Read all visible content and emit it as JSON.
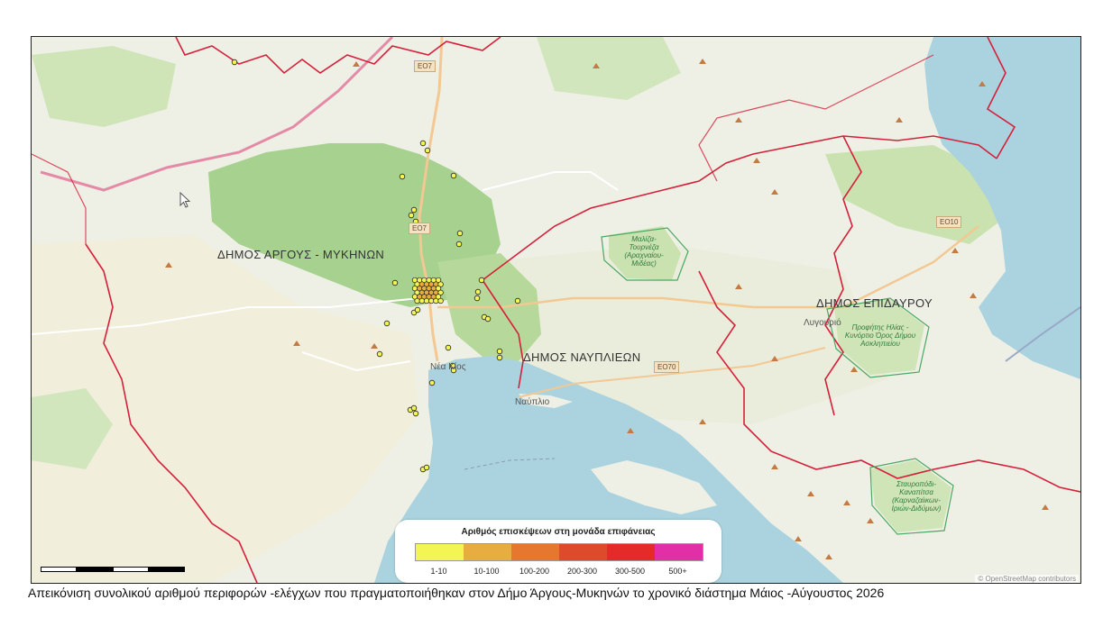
{
  "map": {
    "municipalities": [
      {
        "name": "ΔΗΜΟΣ ΑΡΓΟΥΣ - ΜΥΚΗΝΩΝ"
      },
      {
        "name": "ΔΗΜΟΣ ΝΑΥΠΛΙΕΩΝ"
      },
      {
        "name": "ΔΗΜΟΣ ΕΠΙΔΑΥΡΟΥ"
      }
    ],
    "towns": [
      {
        "name": "Νέα Κίος"
      },
      {
        "name": "Ναύπλιο"
      },
      {
        "name": "Λυγουριό"
      }
    ],
    "protected_areas": [
      {
        "name": "Μαλίζα-Τουρνέζα (Αραχναίου-Μιδέας)"
      },
      {
        "name": "Προφήτης Ηλίας - Κυνόρτιο Όρος Δήμου Ασκληπιείου"
      },
      {
        "name": "Σταυροπόδι-Καναπίτσα (Καρναζαίικων-Ιριών-Διδύμων)"
      }
    ],
    "road_shields": [
      "ΕΟ7",
      "ΕΟ7",
      "ΕΟ70",
      "ΕΟ10"
    ],
    "colors": {
      "water": "#abd3df",
      "forest": "#a7d18e",
      "boundary": "#d61f3a",
      "primary_road": "#e8b9a0",
      "background": "#eef0e6"
    },
    "attribution": "© OpenStreetMap contributors"
  },
  "legend": {
    "title": "Αριθμός επισκέψεων στη μονάδα επιφάνειας",
    "classes": [
      {
        "label": "1-10",
        "color": "#f3f553"
      },
      {
        "label": "10-100",
        "color": "#e7ad40"
      },
      {
        "label": "100-200",
        "color": "#e5772e"
      },
      {
        "label": "200-300",
        "color": "#de4b2b"
      },
      {
        "label": "300-500",
        "color": "#e52a2a"
      },
      {
        "label": "500+",
        "color": "#e22ea7"
      }
    ]
  },
  "caption": "Απεικόνιση συνολικού αριθμού  περιφορών -ελέγχων που πραγματοποιήθηκαν στον  Δήμο Άργους-Μυκηνών το χρονικό διάστημα Μάιος -Αύγουστος 2026"
}
